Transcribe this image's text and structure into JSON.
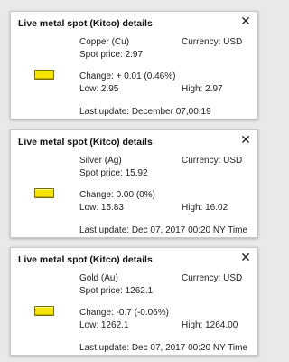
{
  "popups": [
    {
      "title": "Live metal spot (Kitco) details",
      "metal": "Copper (Cu)",
      "currency": "Currency: USD",
      "spot": "Spot price: 2.97",
      "change": "Change: + 0.01 (0.46%)",
      "low": "Low: 2.95",
      "high": "High: 2.97",
      "updated": "Last update: December 07,00:19",
      "close_icon": "close-icon",
      "metal_icon": "gold-bar-icon",
      "icon_color": "#f5e400"
    },
    {
      "title": "Live metal spot (Kitco) details",
      "metal": "Silver (Ag)",
      "currency": "Currency: USD",
      "spot": "Spot price: 15.92",
      "change": "Change:  0.00 (0%)",
      "low": "Low: 15.83",
      "high": "High: 16.02",
      "updated": "Last update: Dec 07, 2017 00:20 NY Time",
      "close_icon": "close-icon",
      "metal_icon": "gold-bar-icon",
      "icon_color": "#f5e400"
    },
    {
      "title": "Live metal spot (Kitco) details",
      "metal": "Gold (Au)",
      "currency": "Currency: USD",
      "spot": "Spot price: 1262.1",
      "change": "Change:  -0.7 (-0.06%)",
      "low": "Low: 1262.1",
      "high": "High: 1264.00",
      "updated": "Last update: Dec 07, 2017 00:20 NY Time",
      "close_icon": "close-icon",
      "metal_icon": "gold-bar-icon",
      "icon_color": "#f5e400"
    }
  ],
  "close_glyph": "✕"
}
